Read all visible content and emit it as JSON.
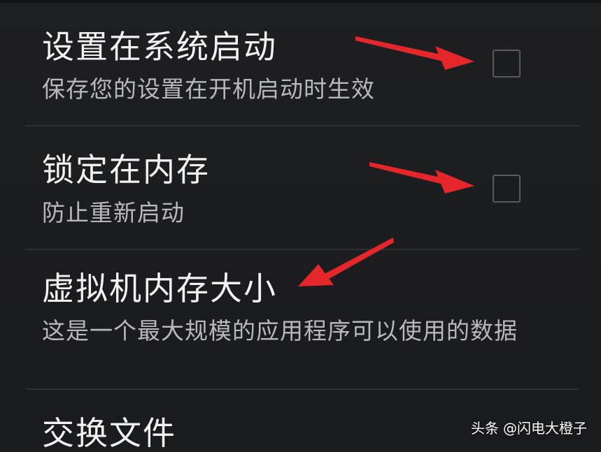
{
  "settings": [
    {
      "title": "设置在系统启动",
      "summary": "保存您的设置在开机启动时生效",
      "checked": false
    },
    {
      "title": "锁定在内存",
      "summary": "防止重新启动",
      "checked": false
    },
    {
      "title": "虚拟机内存大小",
      "summary": "这是一个最大规模的应用程序可以使用的数据"
    },
    {
      "title": "交换文件"
    }
  ],
  "annotation_color": "#e5262b",
  "watermark": {
    "source": "头条",
    "author": "@闪电大橙子"
  }
}
